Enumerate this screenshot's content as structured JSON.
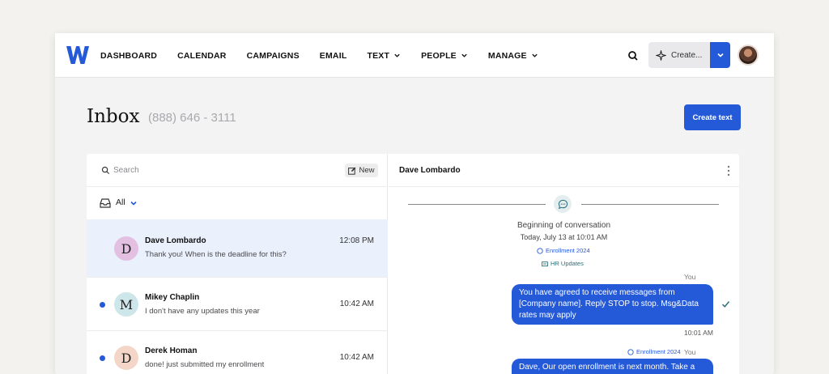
{
  "nav": {
    "items": [
      {
        "label": "DASHBOARD",
        "dropdown": false
      },
      {
        "label": "CALENDAR",
        "dropdown": false
      },
      {
        "label": "CAMPAIGNS",
        "dropdown": false
      },
      {
        "label": "EMAIL",
        "dropdown": false
      },
      {
        "label": "TEXT",
        "dropdown": true
      },
      {
        "label": "PEOPLE",
        "dropdown": true
      },
      {
        "label": "MANAGE",
        "dropdown": true
      }
    ],
    "create_label": "Create...",
    "brand_color": "#2459d8"
  },
  "page": {
    "title": "Inbox",
    "phone": "(888) 646 - 3111",
    "create_text_label": "Create text"
  },
  "inbox": {
    "search_placeholder": "Search",
    "new_label": "New",
    "filter_label": "All",
    "conversations": [
      {
        "initial": "D",
        "name": "Dave Lombardo",
        "preview": "Thank you! When is the deadline for this?",
        "time": "12:08 PM",
        "unread": false,
        "selected": true,
        "avatar_color": "#e3bfe2"
      },
      {
        "initial": "M",
        "name": "Mikey Chaplin",
        "preview": "I don't have any updates this year",
        "time": "10:42 AM",
        "unread": true,
        "selected": false,
        "avatar_color": "#cce6ea"
      },
      {
        "initial": "D",
        "name": "Derek Homan",
        "preview": "done! just submitted my enrollment",
        "time": "10:42 AM",
        "unread": true,
        "selected": false,
        "avatar_color": "#f4d6c9"
      }
    ]
  },
  "thread": {
    "contact_name": "Dave Lombardo",
    "beginning_label": "Beginning of conversation",
    "date_label": "Today, July 13 at 10:01 AM",
    "tags": [
      "Enrollment 2024",
      "HR Updates"
    ],
    "messages": [
      {
        "sender": "You",
        "text": "You have agreed to receive messages from [Company name]. Reply STOP to stop. Msg&Data rates may apply",
        "time": "10:01 AM"
      },
      {
        "sender": "You",
        "tag": "Enrollment 2024",
        "text": "Dave, Our open enrollment is next month. Take a few"
      }
    ]
  }
}
